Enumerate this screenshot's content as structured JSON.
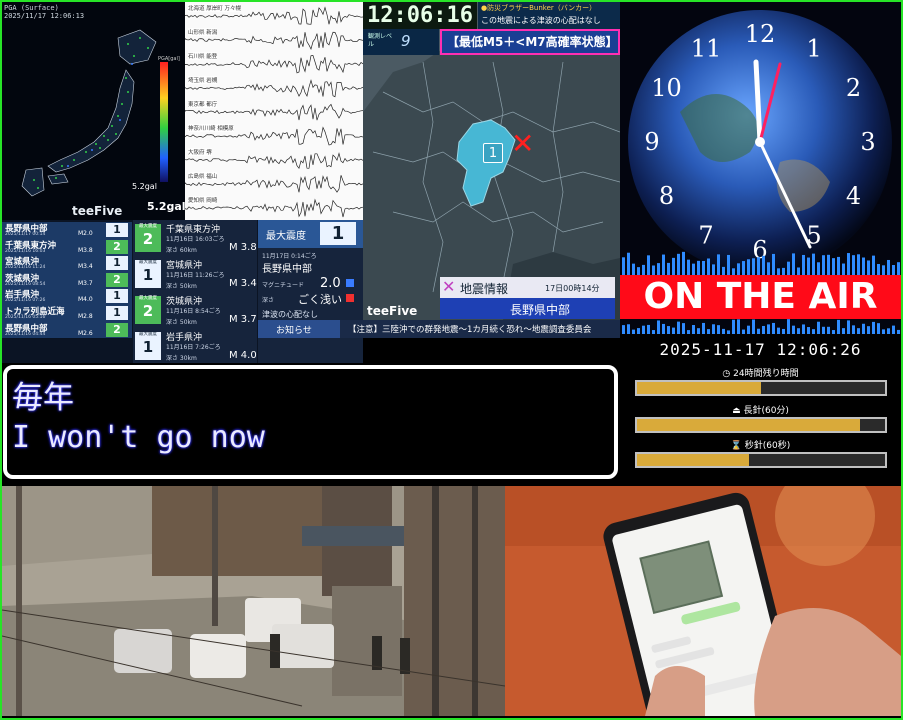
{
  "pga": {
    "title": "PGA (Surface)",
    "timestamp": "2025/11/17 12:06:13",
    "scale_label": "PGA[gal]",
    "max_gal": "5.2gal",
    "bottom_gal": "5.2gal",
    "logo": "teeFive"
  },
  "waveform": {
    "stations": [
      "北海道 厚岸町 万々幌",
      "山形県 新潟",
      "石川県 能登",
      "埼玉県 岩槻",
      "東京都 都庁",
      "神奈川川崎 相模原",
      "大阪府 堺",
      "広島県 福山",
      "愛知県 岡崎"
    ]
  },
  "eq_list": {
    "rows": [
      {
        "place": "長野県中部",
        "date": "2025/11/17 00:14",
        "mag": "M2.0",
        "intensity": "1"
      },
      {
        "place": "千葉県東方沖",
        "date": "2025/11/16 16:03",
        "mag": "M3.8",
        "intensity": "2"
      },
      {
        "place": "宮城県沖",
        "date": "2025/11/16 11:24",
        "mag": "M3.4",
        "intensity": "1"
      },
      {
        "place": "茨城県沖",
        "date": "2025/11/16 08:54",
        "mag": "M3.7",
        "intensity": "2"
      },
      {
        "place": "岩手県沖",
        "date": "2025/11/16 07:26",
        "mag": "M4.0",
        "intensity": "1"
      },
      {
        "place": "トカラ列島近海",
        "date": "2025/11/16 05:16",
        "mag": "M2.8",
        "intensity": "1"
      },
      {
        "place": "長野県中部",
        "date": "2025/11/16 04:44",
        "mag": "M2.6",
        "intensity": "2"
      }
    ],
    "cards": [
      {
        "badge_label": "最大震度",
        "intensity": "2",
        "name": "千葉県東方沖",
        "time": "11月16日 16:03ごろ",
        "detail": "深さ 60km",
        "mag": "M 3.8"
      },
      {
        "badge_label": "最大震度",
        "intensity": "1",
        "name": "宮城県沖",
        "time": "11月16日 11:26ごろ",
        "detail": "深さ 50km",
        "mag": "M 3.4"
      },
      {
        "badge_label": "最大震度",
        "intensity": "2",
        "name": "茨城県沖",
        "time": "11月16日 8:54ごろ",
        "detail": "深さ 50km",
        "mag": "M 3.7"
      },
      {
        "badge_label": "最大震度",
        "intensity": "1",
        "name": "岩手県沖",
        "time": "11月16日 7:26ごろ",
        "detail": "深さ 30km",
        "mag": "M 4.0"
      }
    ]
  },
  "info_panel": {
    "maxint_label": "最大震度",
    "maxint_value": "1",
    "time": "11月17日 0:14ごろ",
    "place": "長野県中部",
    "mag_label": "マグニチュード",
    "mag_value": "2.0",
    "depth_label": "深さ",
    "depth_value": "ごく浅い",
    "tsunami": "津波の心配なし"
  },
  "map_panel": {
    "clock": "12:06:16",
    "top_right_line1": "●防災ブラザーBunker（バンカー）",
    "top_right_line2": "この地震による津波の心配はなし",
    "level_label": "観測レベル",
    "level_value": "9",
    "banner": "【最低M5＋<M7高確率状態】",
    "intensity_marker": "1",
    "info_title": "地震情報",
    "info_time": "17日00時14分",
    "info_place": "長野県中部",
    "logo": "teeFive"
  },
  "notice": {
    "label": "お知らせ",
    "text": "【注意】三陸沖での群発地震〜1カ月続く恐れ〜地震調査委員会"
  },
  "clock_panel": {
    "numbers": [
      "12",
      "1",
      "2",
      "3",
      "4",
      "5",
      "6",
      "7",
      "8",
      "9",
      "10",
      "11"
    ],
    "on_air": "ON THE AIR",
    "datetime": "2025-11-17 12:06:26",
    "bars": [
      {
        "icon": "◷",
        "label": "24時間残り時間",
        "progress": 0.5
      },
      {
        "icon": "⏏",
        "label": "長針(60分)",
        "progress": 0.9
      },
      {
        "icon": "⌛",
        "label": "秒針(60秒)",
        "progress": 0.45
      }
    ]
  },
  "subtitle": {
    "line1": "毎年",
    "line2": "I won't go now"
  },
  "colors": {
    "frame": "#27e427",
    "on_air": "#ff0a18",
    "banner_border": "#ff2fb2",
    "bar_fill": "#d9aa3a"
  }
}
